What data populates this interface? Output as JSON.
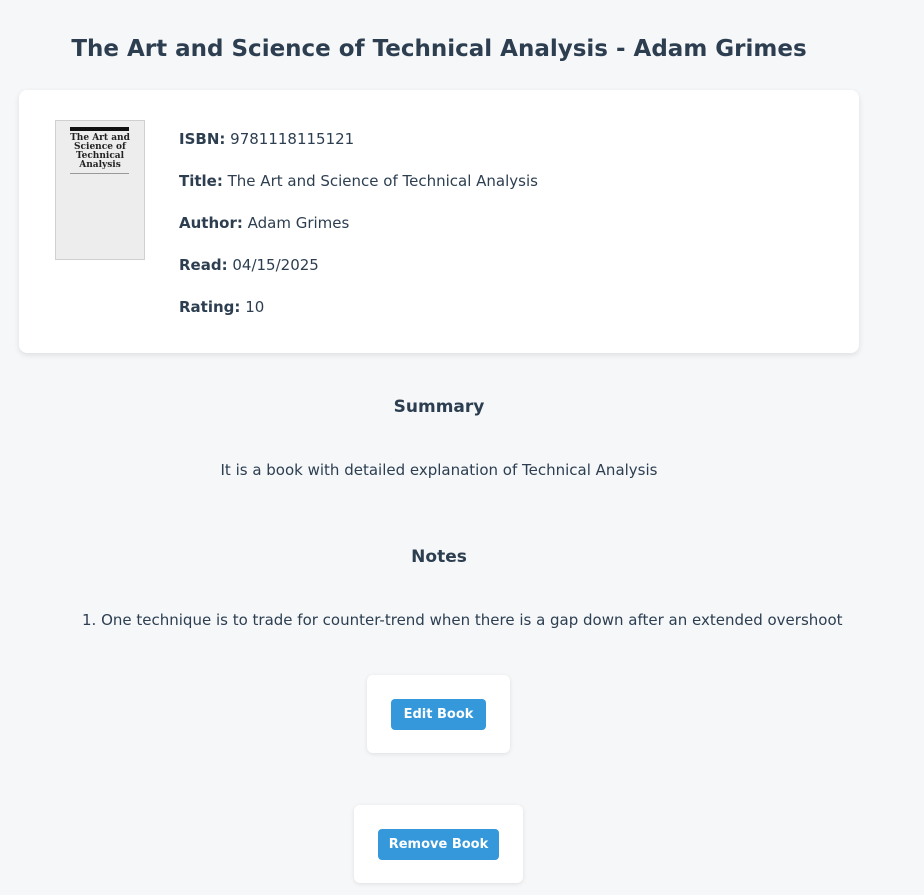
{
  "page": {
    "title": "The Art and Science of Technical Analysis - Adam Grimes"
  },
  "book": {
    "cover_title": "The Art and Science of Technical Analysis",
    "fields": [
      {
        "label": "ISBN:",
        "value": "9781118115121"
      },
      {
        "label": "Title:",
        "value": "The Art and Science of Technical Analysis"
      },
      {
        "label": "Author:",
        "value": "Adam Grimes"
      },
      {
        "label": "Read:",
        "value": "04/15/2025"
      },
      {
        "label": "Rating:",
        "value": "10"
      }
    ]
  },
  "summary": {
    "heading": "Summary",
    "text": "It is a book with detailed explanation of Technical Analysis"
  },
  "notes": {
    "heading": "Notes",
    "items": [
      "1. One technique is to trade for counter-trend when there is a gap down after an extended overshoot"
    ]
  },
  "actions": {
    "edit_label": "Edit Book",
    "remove_label": "Remove Book"
  },
  "colors": {
    "accent": "#3498db",
    "text": "#2c3e50",
    "background": "#f5f7f9"
  }
}
